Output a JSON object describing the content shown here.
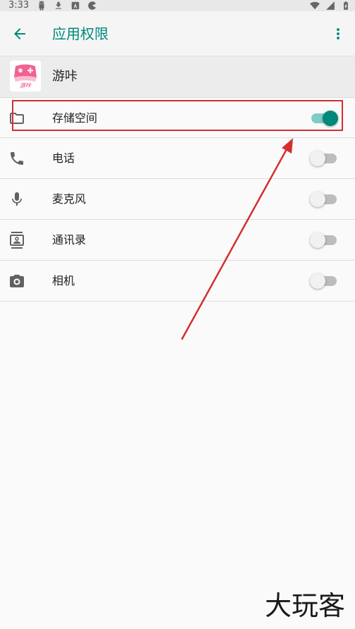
{
  "status_bar": {
    "time": "3:33",
    "left_icons": [
      "android-icon",
      "download-icon",
      "a-badge-icon",
      "pacman-icon"
    ],
    "right_icons": [
      "wifi-icon",
      "signal-icon",
      "battery-icon"
    ]
  },
  "toolbar": {
    "back_icon": "arrow-back-icon",
    "title": "应用权限",
    "overflow_icon": "more-vert-icon"
  },
  "app": {
    "name": "游咔",
    "icon_label": "游咔"
  },
  "permissions": [
    {
      "label": "存储空间",
      "icon": "folder-icon",
      "enabled": true
    },
    {
      "label": "电话",
      "icon": "phone-icon",
      "enabled": false
    },
    {
      "label": "麦克风",
      "icon": "mic-icon",
      "enabled": false
    },
    {
      "label": "通讯录",
      "icon": "contacts-icon",
      "enabled": false
    },
    {
      "label": "相机",
      "icon": "camera-icon",
      "enabled": false
    }
  ],
  "colors": {
    "accent": "#00897b",
    "switch_on_track": "#80cbc4",
    "annotation": "#d32f2f"
  },
  "watermark": "大玩客"
}
